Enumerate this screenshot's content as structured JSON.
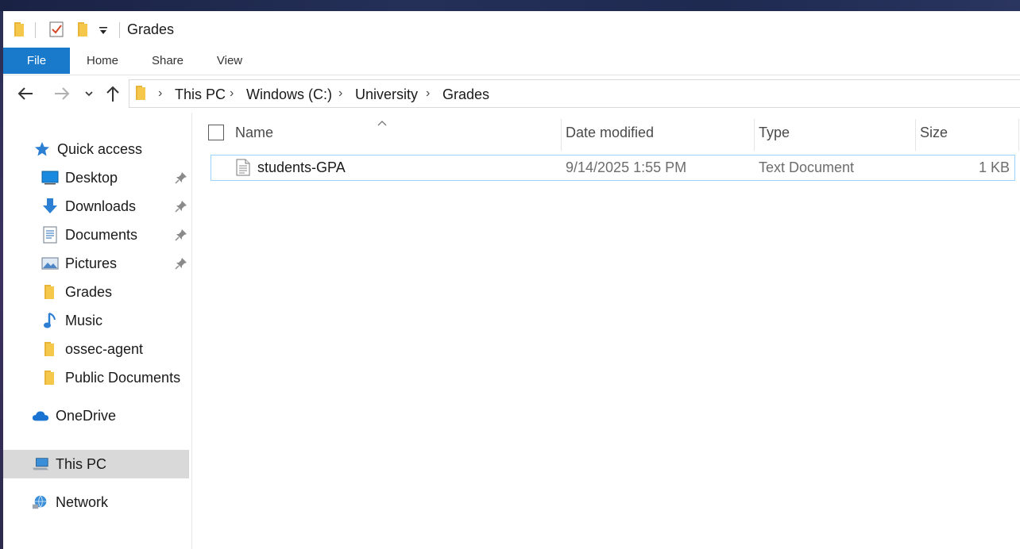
{
  "window": {
    "title": "Grades"
  },
  "ribbon": {
    "tabs": [
      "File",
      "Home",
      "Share",
      "View"
    ]
  },
  "address": {
    "crumbs": [
      "This PC",
      "Windows (C:)",
      "University",
      "Grades"
    ]
  },
  "nav": {
    "quick_access": "Quick access",
    "items": [
      {
        "label": "Desktop",
        "icon": "desktop-icon",
        "pinned": true
      },
      {
        "label": "Downloads",
        "icon": "download-arrow-icon",
        "pinned": true
      },
      {
        "label": "Documents",
        "icon": "documents-icon",
        "pinned": true
      },
      {
        "label": "Pictures",
        "icon": "pictures-icon",
        "pinned": true
      },
      {
        "label": "Grades",
        "icon": "folder-icon",
        "pinned": false
      },
      {
        "label": "Music",
        "icon": "music-note-icon",
        "pinned": false
      },
      {
        "label": "ossec-agent",
        "icon": "folder-icon",
        "pinned": false
      },
      {
        "label": "Public Documents",
        "icon": "folder-icon",
        "pinned": false
      }
    ],
    "onedrive": "OneDrive",
    "this_pc": "This PC",
    "network": "Network"
  },
  "columns": {
    "name": "Name",
    "date": "Date modified",
    "type": "Type",
    "size": "Size"
  },
  "files": [
    {
      "name": "students-GPA",
      "date": "9/14/2025 1:55 PM",
      "type": "Text Document",
      "size": "1 KB"
    }
  ],
  "colors": {
    "accent": "#1979ca",
    "folder": "#f5c84c",
    "selection_border": "#99d1ff"
  }
}
